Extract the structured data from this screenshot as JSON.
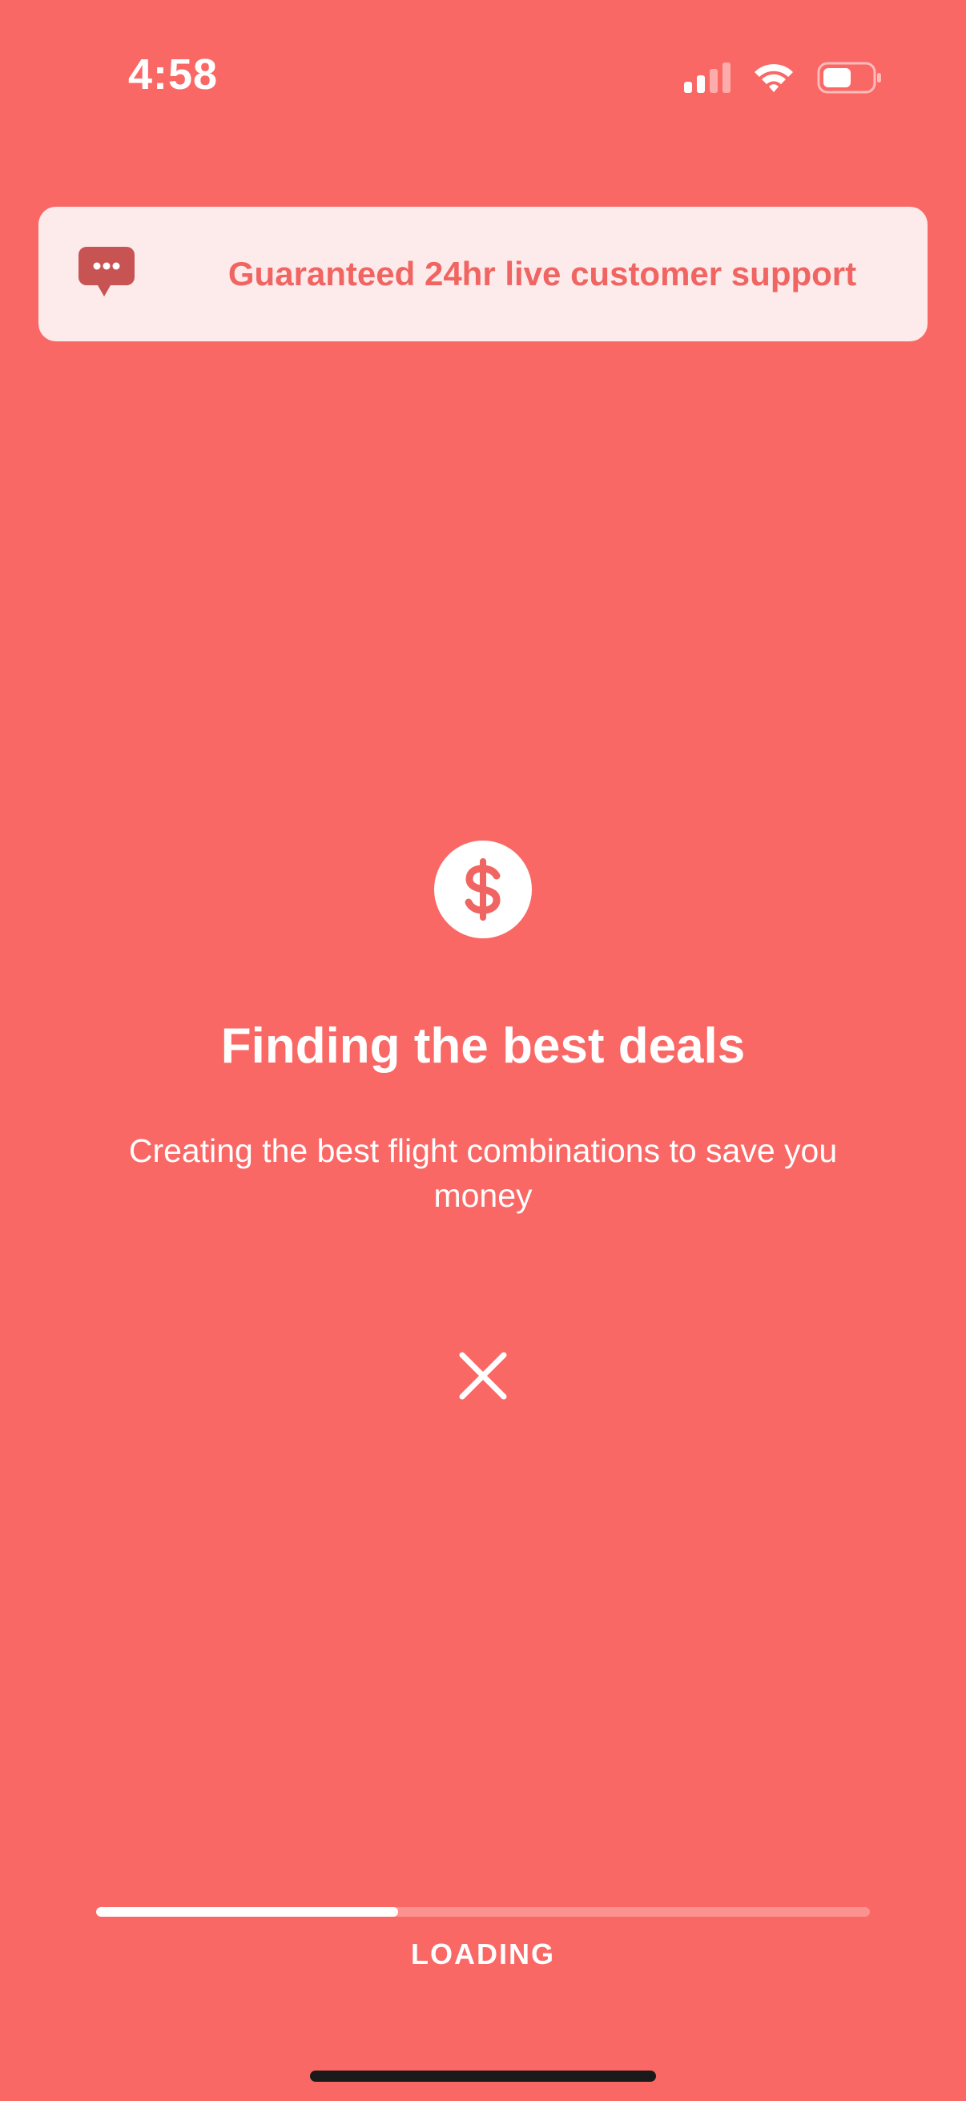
{
  "status_bar": {
    "time": "4:58",
    "icons": [
      "cellular-signal-icon",
      "wifi-icon",
      "battery-icon"
    ]
  },
  "support_banner": {
    "icon": "chat-bubble-icon",
    "text": "Guaranteed 24hr live customer support"
  },
  "loading_screen": {
    "badge_icon": "dollar-icon",
    "title": "Finding the best deals",
    "subtitle": "Creating the best flight combinations to save you money",
    "close_icon": "close-icon"
  },
  "progress": {
    "fraction": 0.39,
    "label": "LOADING"
  },
  "colors": {
    "background": "#FA6866",
    "banner_background": "#FDEAEA",
    "banner_text": "#F06462",
    "chat_icon": "#C75452",
    "white": "#FFFFFF"
  }
}
